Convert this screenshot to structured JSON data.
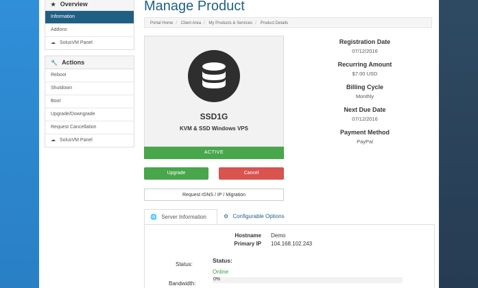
{
  "sidebar": {
    "overview": {
      "title": "Overview",
      "icon": "star-icon",
      "items": [
        {
          "label": "Information",
          "active": true
        },
        {
          "label": "Addons",
          "active": false
        },
        {
          "label": "SolusVM Panel",
          "active": false,
          "icon": "cloud-icon"
        }
      ]
    },
    "actions": {
      "title": "Actions",
      "icon": "wrench-icon",
      "items": [
        {
          "label": "Reboot"
        },
        {
          "label": "Shutdown"
        },
        {
          "label": "Boot"
        },
        {
          "label": "Upgrade/Downgrade"
        },
        {
          "label": "Request Cancellation"
        },
        {
          "label": "SolusVM Panel",
          "icon": "cloud-icon"
        }
      ]
    }
  },
  "page": {
    "title": "Manage Product",
    "breadcrumb": [
      "Portal Home",
      "Client Area",
      "My Products & Services",
      "Product Details"
    ]
  },
  "product": {
    "icon": "database-icon",
    "name": "SSD1G",
    "group": "KVM & SSD Windows VPS",
    "status": "ACTIVE",
    "buttons": {
      "upgrade": "Upgrade",
      "cancel": "Cancel",
      "rdns": "Request rDNS / IP / Migration"
    }
  },
  "info": {
    "registration_label": "Registration Date",
    "registration_value": "07/12/2016",
    "recurring_label": "Recurring Amount",
    "recurring_value": "$7.00 USD",
    "billing_label": "Billing Cycle",
    "billing_value": "Monthly",
    "due_label": "Next Due Date",
    "due_value": "07/12/2016",
    "payment_label": "Payment Method",
    "payment_value": "PayPal"
  },
  "tabs": {
    "server_info": "Server Information",
    "configurable": "Configurable Options"
  },
  "server": {
    "hostname_label": "Hostname",
    "hostname_value": "Demo",
    "ip_label": "Primary IP",
    "ip_value": "104.168.102.243",
    "status_label": "Status:",
    "status_title": "Status:",
    "status_value": "Online",
    "bandwidth_label": "Bandwidth:",
    "bandwidth_value": "0%",
    "bandwidth_fraction": 0
  },
  "colors": {
    "brand_blue": "#1f5f84",
    "success": "#48a64b",
    "danger": "#d9534f",
    "online": "#3c9d40"
  }
}
